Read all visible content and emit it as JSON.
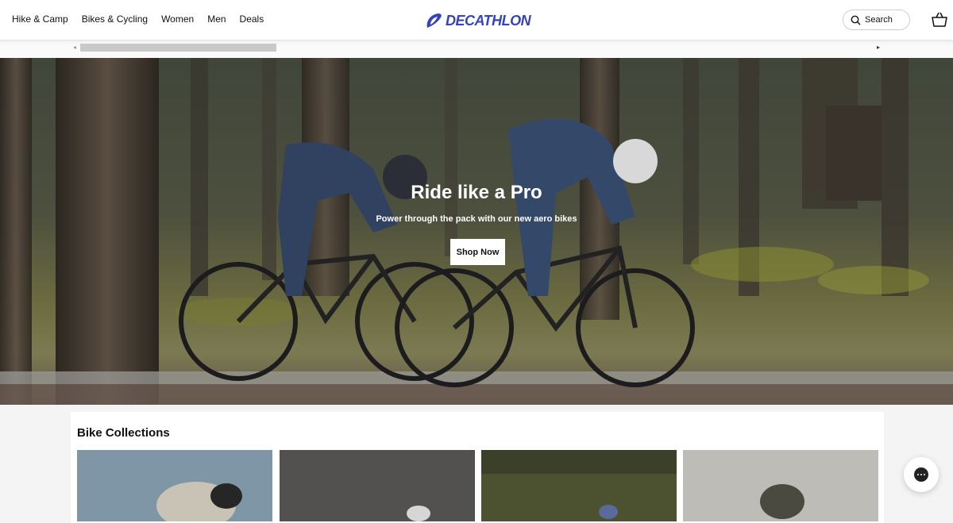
{
  "nav": {
    "items": [
      "Hike & Camp",
      "Bikes & Cycling",
      "Women",
      "Men",
      "Deals"
    ]
  },
  "brand": {
    "name": "DECATHLON",
    "color": "#3643ba"
  },
  "search": {
    "label": "Search"
  },
  "hero": {
    "title": "Ride like a Pro",
    "subtitle": "Power through the pack with our new aero bikes",
    "cta": "Shop Now"
  },
  "collections": {
    "title": "Bike Collections"
  },
  "icons": {
    "search": "search-icon",
    "cart": "cart-icon",
    "chat": "chat-icon"
  }
}
